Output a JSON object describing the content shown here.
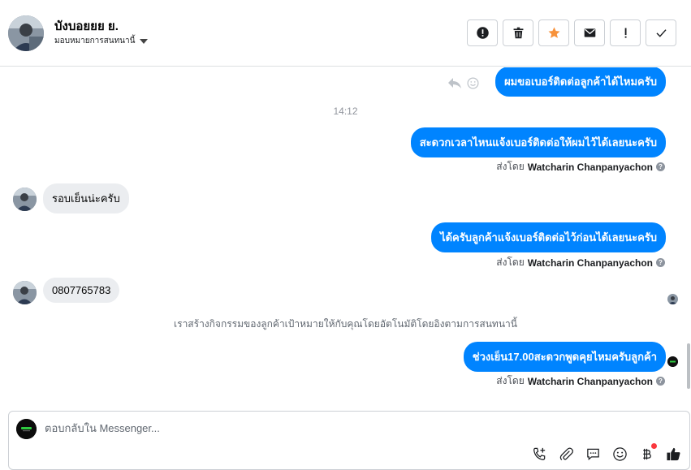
{
  "header": {
    "contact_name": "บังบอยยย ย.",
    "assign_label": "มอบหมายการสนทนานี้",
    "actions": [
      {
        "name": "spam-button",
        "icon": "alert-circle-icon"
      },
      {
        "name": "delete-button",
        "icon": "trash-icon"
      },
      {
        "name": "star-button",
        "icon": "star-icon"
      },
      {
        "name": "mark-unread-button",
        "icon": "envelope-icon"
      },
      {
        "name": "follow-up-button",
        "icon": "exclamation-icon"
      },
      {
        "name": "mark-done-button",
        "icon": "check-icon"
      }
    ],
    "star_color": "#f7923b"
  },
  "thread": {
    "msg1": "ผมขอเบอร์ติดต่อลูกค้าได้ไหมครับ",
    "timestamp": "14:12",
    "msg2": "สะดวกเวลาไหนแจ้งเบอร์ติดต่อให้ผมไว้ได้เลยนะครับ",
    "sent_by_prefix": "ส่งโดย",
    "sender_name": "Watcharin Chanpanyachon",
    "msg3_in": "รอบเย็นน่ะครับ",
    "msg4": "ได้ครับลูกค้าแจ้งเบอร์ติดต่อไว้ก่อนได้เลยนะครับ",
    "msg5_in": "0807765783",
    "system_note": "เราสร้างกิจกรรมของลูกค้าเป้าหมายให้กับคุณโดยอัตโนมัติโดยอิงตามการสนทนานี้",
    "msg6": "ช่วงเย็น17.00สะดวกพูดคุยไหมครับลูกค้า",
    "bubble_color": "#0084ff"
  },
  "composer": {
    "placeholder": "ตอบกลับใน Messenger...",
    "value": ""
  }
}
